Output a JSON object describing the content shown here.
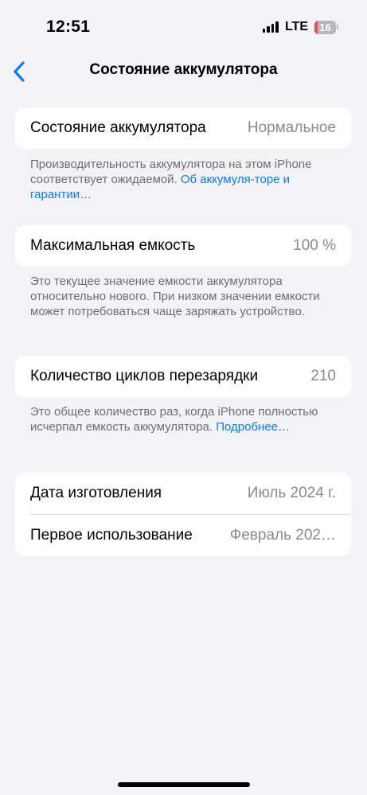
{
  "status_bar": {
    "time": "12:51",
    "network": "LTE",
    "battery_percent": "16",
    "battery_level": 0.16,
    "signal_bars": 4
  },
  "nav": {
    "back_icon": "chevron-left-icon",
    "title": "Состояние аккумулятора"
  },
  "battery_health": {
    "label": "Состояние аккумулятора",
    "value": "Нормальное",
    "note_text": "Производительность аккумулятора на этом iPhone соответствует ожидаемой. ",
    "note_link": "Об аккумуля-­торе и гарантии…"
  },
  "max_capacity": {
    "label": "Максимальная емкость",
    "value": "100 %",
    "note_text": "Это текущее значение емкости аккумулятора относительно нового. При низком значении емкости может потребоваться чаще заряжать устройство."
  },
  "cycle_count": {
    "label": "Количество циклов перезарядки",
    "value": "210",
    "note_text": "Это общее количество раз, когда iPhone полностью исчерпал емкость аккумулятора. ",
    "note_link": "Подробнее…"
  },
  "dates": {
    "manufacture_label": "Дата изготовления",
    "manufacture_value": "Июль 2024 г.",
    "first_use_label": "Первое использование",
    "first_use_value": "Февраль 202…"
  },
  "colors": {
    "accent": "#0a7aff",
    "background": "#f2f2f7",
    "battery_low": "#eb4e3d"
  }
}
